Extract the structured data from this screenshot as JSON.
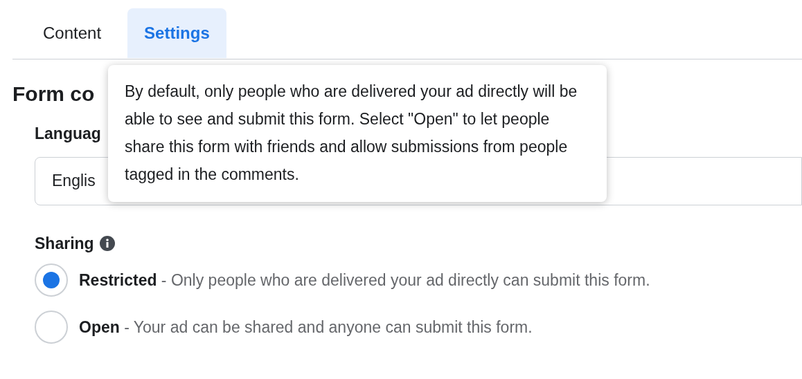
{
  "tabs": [
    {
      "label": "Content",
      "selected": false
    },
    {
      "label": "Settings",
      "selected": true
    }
  ],
  "section_title": "Form co",
  "language": {
    "label": "Languag",
    "value": "Englis"
  },
  "tooltip": "By default, only people who are delivered your ad directly will be able to see and submit this form. Select \"Open\" to let people share this form with friends and allow submissions from people tagged in the comments.",
  "sharing": {
    "label": "Sharing",
    "options": [
      {
        "title": "Restricted",
        "description": " - Only people who are delivered your ad directly can submit this form.",
        "selected": true
      },
      {
        "title": "Open",
        "description": " - Your ad can be shared and anyone can submit this form.",
        "selected": false
      }
    ]
  }
}
